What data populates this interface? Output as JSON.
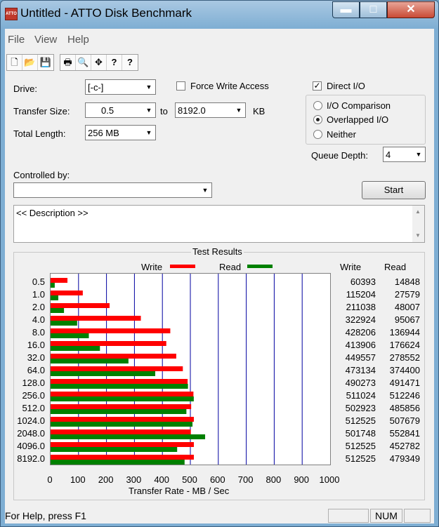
{
  "window": {
    "title": "Untitled - ATTO Disk Benchmark",
    "icon_label": "ATTO",
    "min_glyph": "▬",
    "max_glyph": "□",
    "close_glyph": "✕"
  },
  "menu": {
    "items": [
      "File",
      "View",
      "Help"
    ]
  },
  "toolbar": {
    "icons": [
      "new-file-icon",
      "open-folder-icon",
      "save-icon",
      "print-icon",
      "print-preview-icon",
      "move-icon",
      "help-icon",
      "context-help-icon"
    ],
    "glyphs": [
      "🗋",
      "📂",
      "💾",
      "🖶",
      "🔍",
      "✥",
      "?",
      "?"
    ]
  },
  "form": {
    "drive_label": "Drive:",
    "drive_value": "[-c-]",
    "force_write_label": "Force Write Access",
    "force_write_checked": false,
    "direct_io_label": "Direct I/O",
    "direct_io_checked": true,
    "transfer_size_label": "Transfer Size:",
    "transfer_from": "0.5",
    "to_label": "to",
    "transfer_to": "8192.0",
    "kb_label": "KB",
    "total_length_label": "Total Length:",
    "total_length_value": "256 MB",
    "io_options": [
      {
        "label": "I/O Comparison",
        "selected": false
      },
      {
        "label": "Overlapped I/O",
        "selected": true
      },
      {
        "label": "Neither",
        "selected": false
      }
    ],
    "queue_depth_label": "Queue Depth:",
    "queue_depth_value": "4",
    "controlled_by_label": "Controlled by:",
    "controlled_by_value": "",
    "start_label": "Start",
    "description": "<< Description >>"
  },
  "results": {
    "title": "Test Results",
    "legend_write": "Write",
    "legend_read": "Read",
    "col_write": "Write",
    "col_read": "Read",
    "colors": {
      "write": "#ff0000",
      "read": "#008000",
      "grid": "#0000a0"
    }
  },
  "chart_data": {
    "type": "bar",
    "orientation": "horizontal",
    "categories": [
      "0.5",
      "1.0",
      "2.0",
      "4.0",
      "8.0",
      "16.0",
      "32.0",
      "64.0",
      "128.0",
      "256.0",
      "512.0",
      "1024.0",
      "2048.0",
      "4096.0",
      "8192.0"
    ],
    "series": [
      {
        "name": "Write",
        "values": [
          60393,
          115204,
          211038,
          322924,
          428206,
          413906,
          449557,
          473134,
          490273,
          511024,
          502923,
          512525,
          501748,
          512525,
          512525
        ]
      },
      {
        "name": "Read",
        "values": [
          14848,
          27579,
          48007,
          95067,
          136944,
          176624,
          278552,
          374400,
          491471,
          512246,
          485856,
          507679,
          552841,
          452782,
          479349
        ]
      }
    ],
    "xlabel": "Transfer Rate - MB / Sec",
    "xlim": [
      0,
      1000
    ],
    "xticks": [
      "0",
      "100",
      "200",
      "300",
      "400",
      "500",
      "600",
      "700",
      "800",
      "900",
      "1000"
    ],
    "grid": true,
    "legend": "top"
  },
  "status": {
    "text": "For Help, press F1",
    "num": "NUM"
  }
}
